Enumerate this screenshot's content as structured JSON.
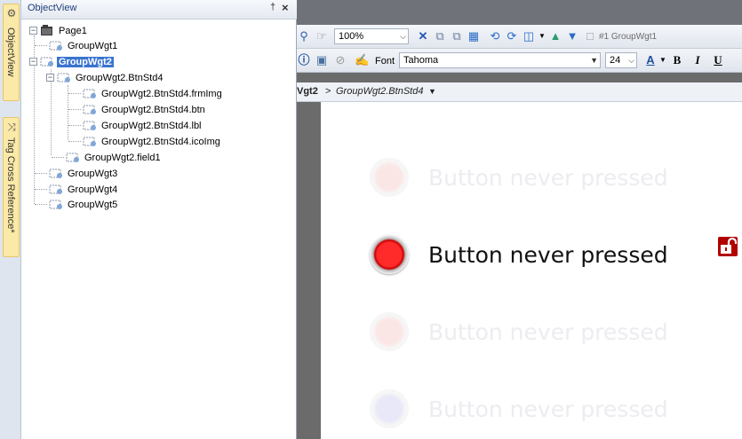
{
  "dock_tabs": {
    "object_view_label": "ObjectView",
    "tag_cross_reference_label": "Tag Cross Reference*"
  },
  "object_view": {
    "title": "ObjectView",
    "pin_label": "↕",
    "close_label": "✕",
    "tree": [
      {
        "label": "Page1"
      },
      {
        "label": "GroupWgt1"
      },
      {
        "label": "GroupWgt2"
      },
      {
        "label": "GroupWgt2.BtnStd4"
      },
      {
        "label": "GroupWgt2.BtnStd4.frmImg"
      },
      {
        "label": "GroupWgt2.BtnStd4.btn"
      },
      {
        "label": "GroupWgt2.BtnStd4.lbl"
      },
      {
        "label": "GroupWgt2.BtnStd4.icoImg"
      },
      {
        "label": "GroupWgt2.field1"
      },
      {
        "label": "GroupWgt3"
      },
      {
        "label": "GroupWgt4"
      },
      {
        "label": "GroupWgt5"
      }
    ],
    "selected_index": 2
  },
  "toolbar1": {
    "zoom_value": "100%",
    "layer_value": "#1 GroupWgt1"
  },
  "toolbar2": {
    "font_label": "Font",
    "font_value": "Tahoma",
    "size_value": "24",
    "bold_label": "B",
    "italic_label": "I",
    "underline_label": "U",
    "font_color_label": "A"
  },
  "breadcrumb": {
    "parent": "Vgt2",
    "separator": ">",
    "current": "GroupWgt2.BtnStd4"
  },
  "canvas": {
    "buttons": [
      {
        "label": "Button never pressed",
        "state": "faded",
        "led_color": "red"
      },
      {
        "label": "Button never pressed",
        "state": "active",
        "led_color": "red"
      },
      {
        "label": "Button never pressed",
        "state": "faded",
        "led_color": "red"
      },
      {
        "label": "Button never pressed",
        "state": "faded",
        "led_color": "blue"
      }
    ]
  },
  "colors": {
    "selection": "#3a74d0",
    "led_red": "#ff2a2a",
    "lock_red": "#b00000",
    "workspace_gray": "#6b6b6b"
  }
}
